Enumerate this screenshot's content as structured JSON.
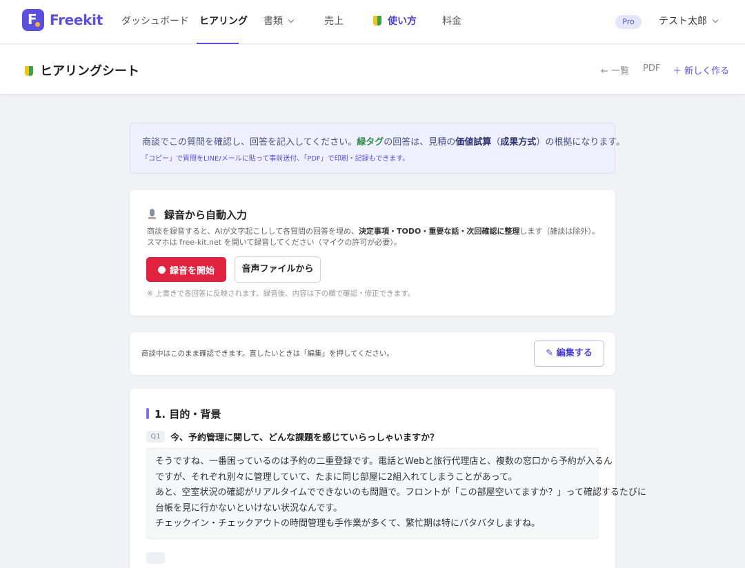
{
  "nav": {
    "logo": "Freekit",
    "items": [
      "ダッシュボード",
      "ヒアリング",
      "書類",
      "売上",
      "使い方",
      "料金"
    ],
    "pro_badge": "Pro",
    "user_name": "テスト太郎"
  },
  "subheader": {
    "title": "ヒアリングシート",
    "back_link": "← 一覧",
    "pdf_link": "PDF",
    "new_link": "＋ 新しく作る"
  },
  "banner": {
    "l1_a": "商談でこの質問を確認し、回答を記入してください。",
    "l1_green": "緑タグ",
    "l1_b": "の回答は、見積の",
    "l1_bold1": "価値試算",
    "l1_c": "（",
    "l1_bold2": "成果方式",
    "l1_d": "）の根拠になります。",
    "line2": "「コピー」で質問をLINE/メールに貼って事前送付、「PDF」で印刷・記録もできます。"
  },
  "recording": {
    "title": "録音から自動入力",
    "desc_a": "商談を録音すると、AIが文字起こしして各質問の回答を埋め、",
    "desc_bold": "決定事項・TODO・重要な話・次回確認に整理",
    "desc_b": "します（雑談は除外）。スマホは free-kit.net を開いて録音してください（マイクの許可が必要）。",
    "start_button": "録音を開始",
    "file_button": "音声ファイルから",
    "note": "※ 上書きで各回答に反映されます。録音後、内容は下の欄で確認・修正できます。"
  },
  "edit_bar": {
    "text": "商談中はこのまま確認できます。直したいときは「編集」を押してください。",
    "button": "✎ 編集する"
  },
  "section": {
    "title": "1. 目的・背景",
    "q_label": "Q1",
    "question": "今、予約管理に関して、どんな課題を感じていらっしゃいますか？",
    "answer_lines": [
      "そうですね、一番困っているのは予約の二重登録です。電話とWebと旅行代理店と、複数の窓口から予約が入るん",
      "ですが、それぞれ別々に管理していて、たまに同じ部屋に2組入れてしまうことがあって。",
      "あと、空室状況の確認がリアルタイムでできないのも問題で。フロントが「この部屋空いてますか？」って確認するたびに",
      "台帳を見に行かないといけない状況なんです。",
      "チェックイン・チェックアウトの時間管理も手作業が多くて、繁忙期は特にバタバタしますね。"
    ]
  }
}
